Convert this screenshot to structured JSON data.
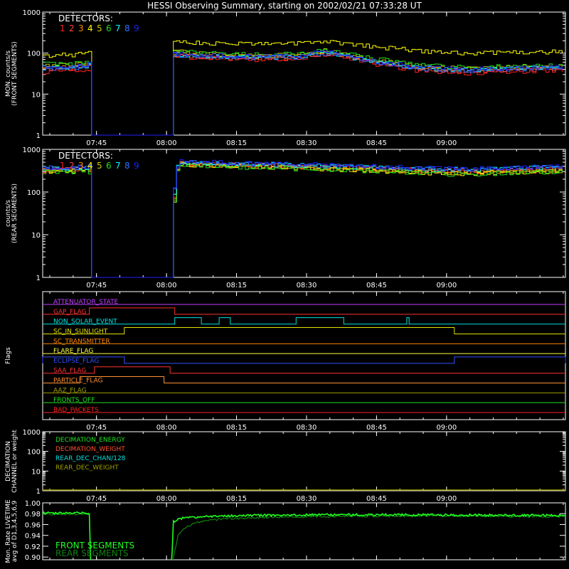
{
  "title": "HESSI Observing Summary, starting on 2002/02/21 07:33:28 UT",
  "colors": {
    "background": "#000000",
    "axes": "#ffffff",
    "det": [
      "#ff2020",
      "#ff4040",
      "#ff8800",
      "#ffff00",
      "#c8c800",
      "#20e020",
      "#00ffff",
      "#3070ff",
      "#2020ff"
    ]
  },
  "time_ticks": [
    "07:45",
    "08:00",
    "08:15",
    "08:30",
    "08:45",
    "09:00"
  ],
  "chart_data": [
    {
      "type": "line",
      "panel": "front",
      "ylabel": [
        "MON. counts/s",
        "(FRONT SEGMENTS)"
      ],
      "yscale": "log",
      "ylim": [
        1,
        1000
      ],
      "ytick_labels": [
        "1",
        "10",
        "100",
        "1000"
      ],
      "legend_title": "DETECTORS:",
      "legend": [
        "1",
        "2",
        "3",
        "4",
        "5",
        "6",
        "7",
        "8",
        "9"
      ],
      "time_range_min": [
        0,
        112
      ],
      "gap_min": [
        10,
        27.6
      ],
      "series": [
        {
          "name": "1",
          "x": [
            0,
            5,
            9,
            28,
            35,
            45,
            55,
            60,
            70,
            80,
            90,
            100,
            112
          ],
          "y": [
            35,
            38,
            40,
            85,
            75,
            70,
            72,
            95,
            55,
            38,
            32,
            36,
            38
          ]
        },
        {
          "name": "2",
          "x": [
            0,
            5,
            9,
            28,
            35,
            45,
            55,
            60,
            70,
            80,
            90,
            100,
            112
          ],
          "y": [
            40,
            42,
            45,
            90,
            80,
            75,
            78,
            100,
            60,
            42,
            36,
            40,
            42
          ]
        },
        {
          "name": "3",
          "x": [
            0,
            5,
            9,
            28,
            35,
            45,
            55,
            60,
            70,
            80,
            90,
            100,
            112
          ],
          "y": [
            45,
            48,
            50,
            100,
            88,
            82,
            85,
            110,
            65,
            45,
            40,
            44,
            46
          ]
        },
        {
          "name": "4",
          "x": [
            0,
            5,
            9,
            28,
            35,
            45,
            55,
            60,
            70,
            80,
            90,
            100,
            112
          ],
          "y": [
            85,
            90,
            95,
            200,
            170,
            165,
            175,
            200,
            145,
            115,
            100,
            105,
            108
          ]
        },
        {
          "name": "5",
          "x": [
            0,
            5,
            9,
            28,
            35,
            45,
            55,
            60,
            70,
            80,
            90,
            100,
            112
          ],
          "y": [
            50,
            52,
            55,
            110,
            95,
            88,
            92,
            115,
            70,
            48,
            42,
            46,
            48
          ]
        },
        {
          "name": "6",
          "x": [
            0,
            5,
            9,
            28,
            35,
            45,
            55,
            60,
            70,
            80,
            90,
            100,
            112
          ],
          "y": [
            55,
            56,
            58,
            115,
            100,
            92,
            96,
            120,
            75,
            52,
            45,
            48,
            50
          ]
        },
        {
          "name": "7",
          "x": [
            0,
            5,
            9,
            28,
            35,
            45,
            55,
            60,
            70,
            80,
            90,
            100,
            112
          ],
          "y": [
            45,
            46,
            48,
            95,
            85,
            80,
            82,
            105,
            62,
            44,
            38,
            42,
            44
          ]
        },
        {
          "name": "8",
          "x": [
            0,
            5,
            9,
            28,
            35,
            45,
            55,
            60,
            70,
            80,
            90,
            100,
            112
          ],
          "y": [
            42,
            44,
            46,
            92,
            82,
            78,
            80,
            102,
            60,
            43,
            37,
            41,
            43
          ]
        },
        {
          "name": "9",
          "x": [
            0,
            5,
            9,
            28,
            35,
            45,
            55,
            60,
            70,
            80,
            90,
            100,
            112
          ],
          "y": [
            48,
            50,
            52,
            98,
            88,
            84,
            86,
            108,
            66,
            46,
            40,
            44,
            46
          ]
        }
      ]
    },
    {
      "type": "line",
      "panel": "rear",
      "ylabel": [
        "counts/s",
        "(REAR SEGMENTS)"
      ],
      "yscale": "log",
      "ylim": [
        1,
        1000
      ],
      "ytick_labels": [
        "1",
        "10",
        "100",
        "1000"
      ],
      "legend_title": "DETECTORS:",
      "legend": [
        "1",
        "2",
        "3",
        "4",
        "5",
        "6",
        "7",
        "8",
        "9"
      ],
      "time_range_min": [
        0,
        112
      ],
      "gap_min": [
        10,
        27.6
      ],
      "series": [
        {
          "name": "1",
          "x": [
            0,
            5,
            9,
            28,
            29,
            40,
            60,
            80,
            90,
            100,
            112
          ],
          "y": [
            330,
            340,
            350,
            80,
            480,
            430,
            380,
            320,
            300,
            330,
            350
          ]
        },
        {
          "name": "2",
          "x": [
            0,
            5,
            9,
            28,
            29,
            40,
            60,
            80,
            90,
            100,
            112
          ],
          "y": [
            340,
            350,
            360,
            90,
            490,
            440,
            390,
            330,
            310,
            340,
            360
          ]
        },
        {
          "name": "3",
          "x": [
            0,
            5,
            9,
            28,
            29,
            40,
            60,
            80,
            90,
            100,
            112
          ],
          "y": [
            320,
            330,
            340,
            70,
            460,
            420,
            370,
            300,
            280,
            300,
            320
          ]
        },
        {
          "name": "4",
          "x": [
            0,
            5,
            9,
            28,
            29,
            40,
            60,
            80,
            90,
            100,
            112
          ],
          "y": [
            300,
            310,
            320,
            60,
            440,
            400,
            350,
            290,
            270,
            290,
            310
          ]
        },
        {
          "name": "5",
          "x": [
            0,
            5,
            9,
            28,
            29,
            40,
            60,
            80,
            90,
            100,
            112
          ],
          "y": [
            310,
            320,
            330,
            65,
            450,
            410,
            360,
            300,
            280,
            300,
            320
          ]
        },
        {
          "name": "6",
          "x": [
            0,
            5,
            9,
            28,
            29,
            40,
            60,
            80,
            90,
            100,
            112
          ],
          "y": [
            290,
            300,
            310,
            60,
            430,
            390,
            340,
            280,
            260,
            280,
            300
          ]
        },
        {
          "name": "7",
          "x": [
            0,
            5,
            9,
            28,
            29,
            40,
            60,
            80,
            90,
            100,
            112
          ],
          "y": [
            360,
            370,
            380,
            100,
            520,
            460,
            410,
            350,
            330,
            360,
            380
          ]
        },
        {
          "name": "8",
          "x": [
            0,
            5,
            9,
            28,
            29,
            40,
            60,
            80,
            90,
            100,
            112
          ],
          "y": [
            370,
            380,
            390,
            110,
            530,
            470,
            420,
            360,
            340,
            370,
            390
          ]
        },
        {
          "name": "9",
          "x": [
            0,
            5,
            9,
            28,
            29,
            40,
            60,
            80,
            90,
            100,
            112
          ],
          "y": [
            380,
            390,
            400,
            120,
            540,
            480,
            430,
            370,
            350,
            380,
            400
          ]
        }
      ]
    },
    {
      "type": "line",
      "panel": "flags",
      "ylabel": [
        "Flags"
      ],
      "time_range_min": [
        0,
        112
      ],
      "flags": [
        {
          "name": "ATTENUATOR_STATE",
          "color": "#c040ff",
          "high": []
        },
        {
          "name": "GAP_FLAG",
          "color": "#ff3030",
          "high": [
            [
              10,
              28.3
            ]
          ]
        },
        {
          "name": "NON_SOLAR_EVENT",
          "color": "#00e0e0",
          "high": [
            [
              28.3,
              34
            ],
            [
              37.8,
              40.2
            ],
            [
              54.3,
              64.5
            ],
            [
              78,
              78.5
            ]
          ]
        },
        {
          "name": "SC_IN_SUNLIGHT",
          "color": "#e0e000",
          "high": [
            [
              17.5,
              88.2
            ]
          ]
        },
        {
          "name": "SC_TRANSMITTER",
          "color": "#ff8800",
          "high": []
        },
        {
          "name": "FLARE_FLAG",
          "color": "#ffff40",
          "high": []
        },
        {
          "name": "ECLIPSE_FLAG",
          "color": "#3050ff",
          "high": [
            [
              0,
              17.5
            ],
            [
              88.2,
              112
            ]
          ]
        },
        {
          "name": "SAA_FLAG",
          "color": "#ff3030",
          "high": [
            [
              11.1,
              27.3
            ]
          ]
        },
        {
          "name": "PARTICLE_FLAG",
          "color": "#ff9030",
          "high": [
            [
              8,
              26
            ]
          ]
        },
        {
          "name": "AAZ_FLAG",
          "color": "#a0a000",
          "high": []
        },
        {
          "name": "FRONTS_OFF",
          "color": "#20e020",
          "high": []
        },
        {
          "name": "BAD_PACKETS",
          "color": "#ff2020",
          "high": []
        }
      ]
    },
    {
      "type": "line",
      "panel": "decimation",
      "ylabel": [
        "DECIMATION",
        "CHANNEL or weight"
      ],
      "yscale": "log",
      "ylim": [
        1,
        1000
      ],
      "ytick_labels": [
        "1",
        "10",
        "100",
        "1000"
      ],
      "time_range_min": [
        0,
        112
      ],
      "legend": [
        {
          "name": "DECIMATION_ENERGY",
          "color": "#20e020"
        },
        {
          "name": "DECIMATION_WEIGHT",
          "color": "#ff5030"
        },
        {
          "name": "REAR_DEC_CHAN/128",
          "color": "#00e0e0"
        },
        {
          "name": "REAR_DEC_WEIGHT",
          "color": "#a0a000"
        }
      ],
      "series": [
        {
          "name": "REAR_DEC_WEIGHT",
          "x": [
            0,
            112
          ],
          "y": [
            1,
            1
          ]
        }
      ]
    },
    {
      "type": "line",
      "panel": "livetime",
      "ylabel": [
        "Mon. Rate LIVETIME",
        "avg of D1,3,4,5,6,9"
      ],
      "ylim": [
        0.895,
        1.0
      ],
      "ytick_labels": [
        "0.90",
        "0.92",
        "0.94",
        "0.96",
        "0.98",
        "1.00"
      ],
      "time_range_min": [
        0,
        112
      ],
      "legend": [
        {
          "name": "FRONT SEGMENTS",
          "color": "#20ff20"
        },
        {
          "name": "REAR SEGMENTS",
          "color": "#108010"
        }
      ],
      "series": [
        {
          "name": "FRONT SEGMENTS",
          "x": [
            0,
            10,
            10.3,
            27.6,
            28,
            30,
            35,
            45,
            60,
            80,
            100,
            112
          ],
          "y": [
            0.981,
            0.981,
            0.88,
            0.88,
            0.966,
            0.972,
            0.975,
            0.977,
            0.978,
            0.978,
            0.977,
            0.977
          ]
        },
        {
          "name": "REAR SEGMENTS",
          "x": [
            0,
            10,
            10.3,
            27.6,
            28,
            29,
            31,
            34,
            38,
            45,
            60,
            80,
            100,
            112
          ],
          "y": [
            0.979,
            0.979,
            0.88,
            0.88,
            0.9,
            0.94,
            0.957,
            0.966,
            0.97,
            0.973,
            0.975,
            0.976,
            0.975,
            0.975
          ]
        }
      ]
    }
  ]
}
